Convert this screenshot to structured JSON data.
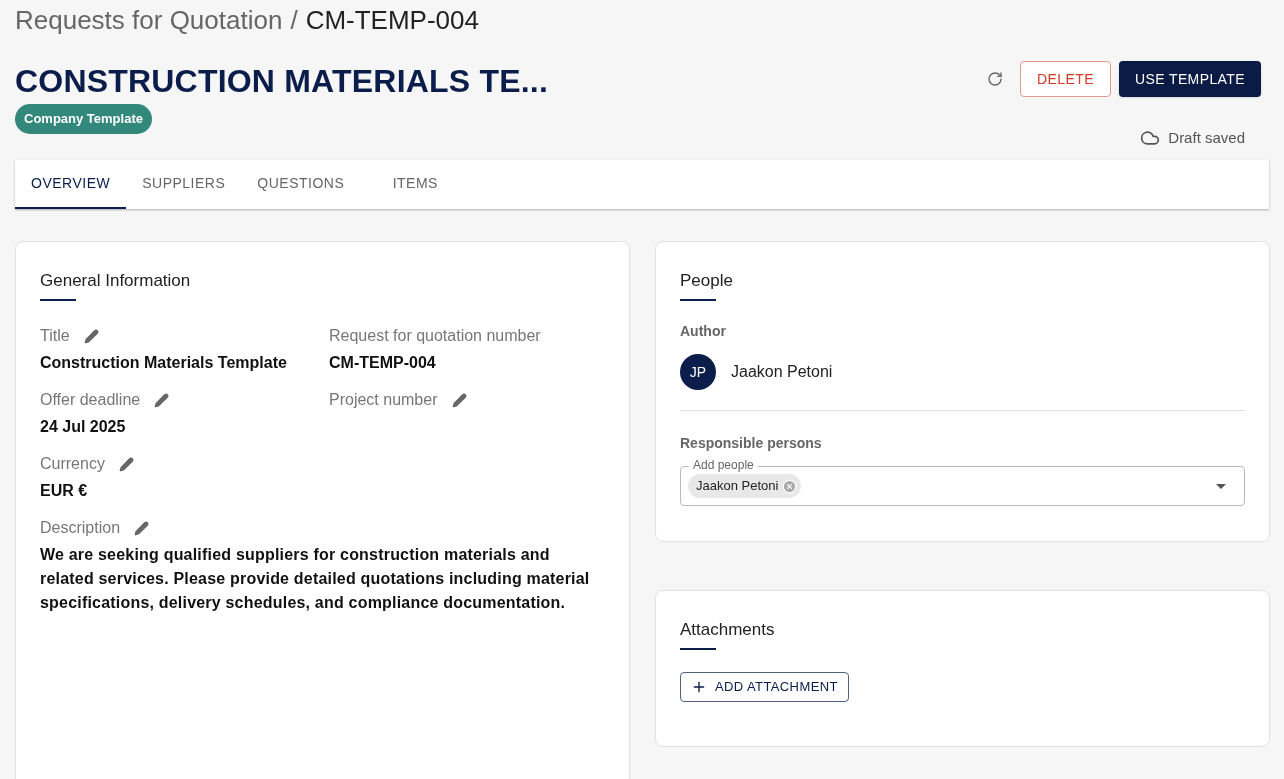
{
  "breadcrumb": {
    "parent": "Requests for Quotation",
    "separator": "/",
    "current": "CM-TEMP-004"
  },
  "title": "CONSTRUCTION MATERIALS TE...",
  "badge": "Company Template",
  "actions": [
    {
      "label": "DELETE",
      "kind": "danger"
    },
    {
      "label": "USE TEMPLATE",
      "kind": "primary"
    }
  ],
  "save_status": "Draft saved",
  "tabs": [
    {
      "label": "OVERVIEW",
      "selected": true
    },
    {
      "label": "SUPPLIERS",
      "selected": false
    },
    {
      "label": "QUESTIONS",
      "selected": false
    },
    {
      "label": "ITEMS",
      "selected": false
    }
  ],
  "general_information": {
    "heading": "General Information",
    "fields": [
      {
        "label": "Title",
        "value": "Construction Materials Template",
        "editable": true,
        "kind": "short"
      },
      {
        "label": "Request for quotation number",
        "value": "CM-TEMP-004",
        "editable": false,
        "kind": "short"
      },
      {
        "label": "Offer deadline",
        "value": "24 Jul 2025",
        "editable": true,
        "kind": "short"
      },
      {
        "label": "Project number",
        "editable": true,
        "kind": "short"
      },
      {
        "label": "Currency",
        "value": "EUR €",
        "editable": true,
        "kind": "short"
      },
      {
        "label": "Description",
        "value": "We are seeking qualified suppliers for construction materials and related services. Please provide detailed quotations including material specifications, delivery schedules, and compliance documentation.",
        "editable": true,
        "kind": "paragraph"
      }
    ]
  },
  "people": {
    "heading": "People",
    "author": {
      "label": "Author",
      "initials": "JP",
      "name": "Jaakon Petoni"
    },
    "responsible": {
      "label": "Responsible persons",
      "field_label": "Add people",
      "chips": [
        "Jaakon Petoni"
      ]
    }
  },
  "attachments": {
    "heading": "Attachments",
    "button": "ADD ATTACHMENT"
  }
}
